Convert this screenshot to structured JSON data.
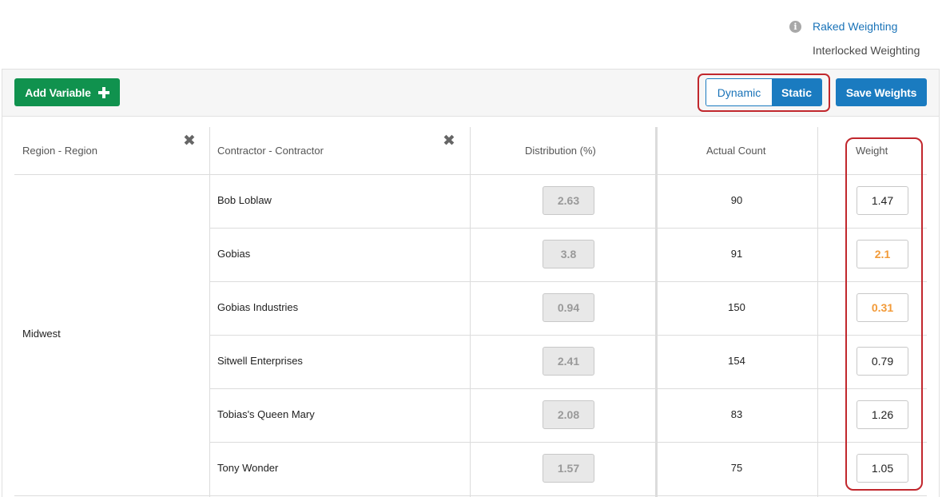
{
  "top_links": {
    "info_icon": "info-icon",
    "raked": "Raked Weighting",
    "interlocked": "Interlocked Weighting"
  },
  "toolbar": {
    "add_variable_label": "Add Variable",
    "add_variable_icon": "plus-icon",
    "mode_dynamic": "Dynamic",
    "mode_static": "Static",
    "mode_selected": "Static",
    "save_label": "Save Weights"
  },
  "table": {
    "headers": {
      "region": "Region - Region",
      "contractor": "Contractor - Contractor",
      "distribution": "Distribution (%)",
      "actual_count": "Actual Count",
      "weight": "Weight"
    },
    "remove_icon": "close-icon",
    "region_value": "Midwest",
    "rows": [
      {
        "contractor": "Bob Loblaw",
        "distribution": "2.63",
        "actual_count": "90",
        "weight": "1.47",
        "weight_changed": false
      },
      {
        "contractor": "Gobias",
        "distribution": "3.8",
        "actual_count": "91",
        "weight": "2.1",
        "weight_changed": true
      },
      {
        "contractor": "Gobias Industries",
        "distribution": "0.94",
        "actual_count": "150",
        "weight": "0.31",
        "weight_changed": true
      },
      {
        "contractor": "Sitwell Enterprises",
        "distribution": "2.41",
        "actual_count": "154",
        "weight": "0.79",
        "weight_changed": false
      },
      {
        "contractor": "Tobias's Queen Mary",
        "distribution": "2.08",
        "actual_count": "83",
        "weight": "1.26",
        "weight_changed": false
      },
      {
        "contractor": "Tony Wonder",
        "distribution": "1.57",
        "actual_count": "75",
        "weight": "1.05",
        "weight_changed": false
      }
    ]
  },
  "colors": {
    "primary_blue": "#1a7bc0",
    "add_green": "#10924e",
    "highlight_red": "#c1272d",
    "changed_orange": "#f29a38"
  }
}
